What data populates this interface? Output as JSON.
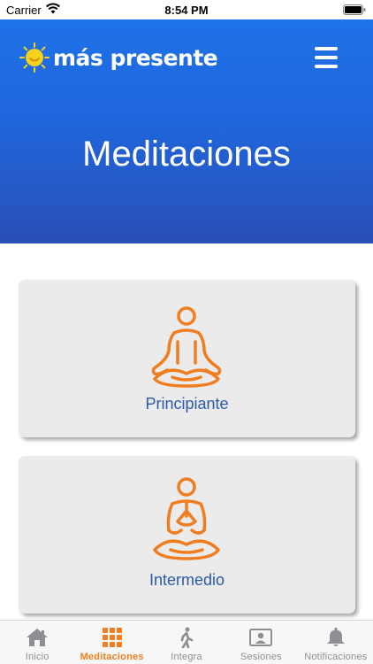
{
  "status_bar": {
    "carrier": "Carrier",
    "time": "8:54 PM"
  },
  "header": {
    "brand": "más presente",
    "title": "Meditaciones"
  },
  "cards": [
    {
      "label": "Principiante",
      "icon": "meditation-pose-icon"
    },
    {
      "label": "Intermedio",
      "icon": "meditation-prayer-icon"
    }
  ],
  "tabbar": {
    "tabs": [
      {
        "label": "Inicio",
        "icon": "home-icon"
      },
      {
        "label": "Meditaciones",
        "icon": "grid-icon",
        "active": true
      },
      {
        "label": "Integra",
        "icon": "walking-icon"
      },
      {
        "label": "Sesiones",
        "icon": "session-icon"
      },
      {
        "label": "Notificaciones",
        "icon": "bell-icon"
      }
    ]
  },
  "colors": {
    "header_top": "#1f72e8",
    "header_bottom": "#2a4fb6",
    "accent": "#f07d1f",
    "card_label": "#2d5aa8",
    "inactive": "#8e8e93"
  }
}
